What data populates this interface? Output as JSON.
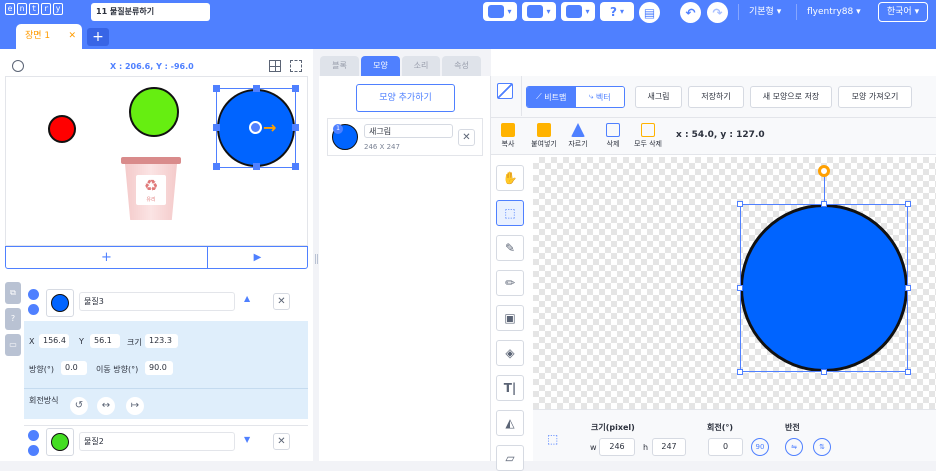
{
  "topbar": {
    "logo_letters": [
      "e",
      "n",
      "t",
      "r",
      "y"
    ],
    "project_title": "11 물질분류하기",
    "mode_label": "기본형",
    "user_label": "flyentry88",
    "language_label": "한국어",
    "help_label": "?"
  },
  "scene": {
    "tab_label": "장면 1",
    "close_glyph": "✕",
    "add_glyph": "+"
  },
  "stage": {
    "coords": "X : 206.6, Y : -96.0",
    "add_glyph": "+",
    "play_glyph": "▶",
    "trash_text": "유리"
  },
  "objects": [
    {
      "name": "물질3",
      "color": "#0064ff",
      "x": "156.4",
      "y": "56.1",
      "size": "123.3",
      "direction": "0.0",
      "move_direction": "90.0"
    },
    {
      "name": "물질2",
      "color": "#44dd22"
    }
  ],
  "props": {
    "x_label": "X",
    "y_label": "Y",
    "size_label": "크기",
    "direction_label": "방향(°)",
    "move_direction_label": "이동 방향(°)",
    "rotation_label": "회전방식"
  },
  "content_tabs": [
    "블록",
    "모양",
    "소리",
    "속성"
  ],
  "shape_panel": {
    "add_button": "모양 추가하기",
    "item_index": "1",
    "item_name": "새그림",
    "item_size": "246 X 247"
  },
  "editor": {
    "bitmap_label": "비트맵",
    "vector_label": "벡터",
    "buttons": [
      "새그림",
      "저장하기",
      "새 모양으로 저장",
      "모양 가져오기"
    ],
    "tools": [
      "복사",
      "붙여넣기",
      "자르기",
      "삭제",
      "모두 삭제"
    ],
    "coords": "x : 54.0, y : 127.0",
    "size_label": "크기(pixel)",
    "w_label": "w",
    "w_value": "246",
    "h_label": "h",
    "h_value": "247",
    "rotation_label": "회전(°)",
    "rotation_value": "0",
    "flip_label": "반전",
    "rotate90_label": "90",
    "shape_color": "#0064ff"
  },
  "colors": {
    "accent": "#4f80ff",
    "orange": "#ff9b00"
  }
}
